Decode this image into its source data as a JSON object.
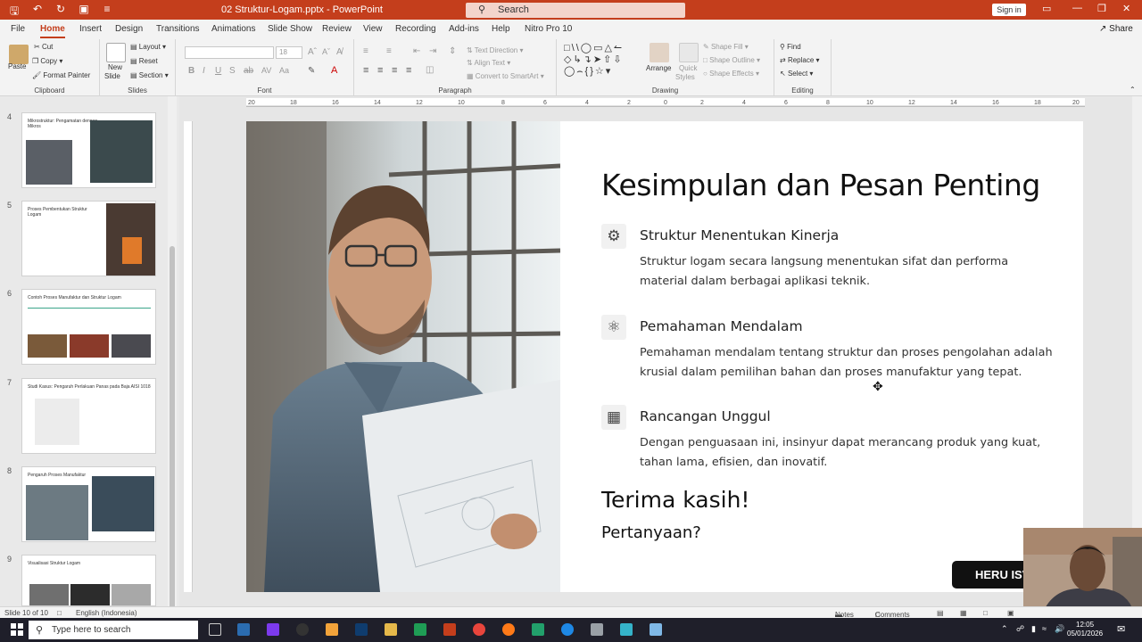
{
  "app": {
    "window_title": "02 Struktur-Logam.pptx  -  PowerPoint",
    "search_placeholder": "Search",
    "sign_in": "Sign in"
  },
  "menu": {
    "tabs": [
      "File",
      "Home",
      "Insert",
      "Design",
      "Transitions",
      "Animations",
      "Slide Show",
      "Review",
      "View",
      "Recording",
      "Add-ins",
      "Help",
      "Nitro Pro 10"
    ],
    "active": "Home",
    "share": "Share"
  },
  "ribbon": {
    "clipboard": {
      "paste": "Paste",
      "cut": "Cut",
      "copy": "Copy",
      "format_painter": "Format Painter",
      "label": "Clipboard"
    },
    "slides": {
      "new_slide": "New",
      "new_slide2": "Slide",
      "layout": "Layout",
      "reset": "Reset",
      "section": "Section",
      "label": "Slides"
    },
    "font": {
      "font_size": "18",
      "label": "Font"
    },
    "paragraph": {
      "text_direction": "Text Direction",
      "align_text": "Align Text",
      "convert_smartart": "Convert to SmartArt",
      "label": "Paragraph"
    },
    "drawing": {
      "arrange": "Arrange",
      "quick_styles": "Quick",
      "quick_styles2": "Styles",
      "shape_fill": "Shape Fill",
      "shape_outline": "Shape Outline",
      "shape_effects": "Shape Effects",
      "label": "Drawing"
    },
    "editing": {
      "find": "Find",
      "replace": "Replace",
      "select": "Select",
      "label": "Editing"
    }
  },
  "thumbnails": [
    {
      "num": "4",
      "title": "Mikrostruktur: Pengamatan dengan Mikros"
    },
    {
      "num": "5",
      "title": "Proses Pembentukan Struktur Logam"
    },
    {
      "num": "6",
      "title": "Contoh Proses Manufaktur dan Struktur Logam"
    },
    {
      "num": "7",
      "title": "Studi Kasus: Pengaruh Perlakuan Panas pada Baja AISI 1018"
    },
    {
      "num": "8",
      "title": "Pengaruh Proses Manufaktur"
    },
    {
      "num": "9",
      "title": "Visualisasi Struktur Logam"
    }
  ],
  "slide": {
    "title": "Kesimpulan dan Pesan Penting",
    "items": [
      {
        "icon": "gear-icon",
        "heading": "Struktur Menentukan Kinerja",
        "body": "Struktur logam secara langsung menentukan sifat dan performa material dalam berbagai aplikasi teknik."
      },
      {
        "icon": "atom-icon",
        "heading": "Pemahaman Mendalam",
        "body": "Pemahaman mendalam tentang struktur dan proses pengolahan adalah krusial dalam pemilihan bahan dan proses manufaktur yang tepat."
      },
      {
        "icon": "building-icon",
        "heading": "Rancangan Unggul",
        "body": "Dengan penguasaan ini, insinyur dapat merancang produk yang kuat, tahan lama, efisien, dan inovatif."
      }
    ],
    "thanks": "Terima kasih!",
    "questions": "Pertanyaan?",
    "badge": "HERU ISV"
  },
  "status": {
    "slide_of": "Slide 10 of 10",
    "language": "English (Indonesia)",
    "notes": "Notes",
    "comments": "Comments"
  },
  "taskbar": {
    "search_placeholder": "Type here to search",
    "time": "12:05",
    "date": "05/01/2026"
  },
  "colors": {
    "accent": "#c43e1c",
    "badge": "#111111"
  }
}
